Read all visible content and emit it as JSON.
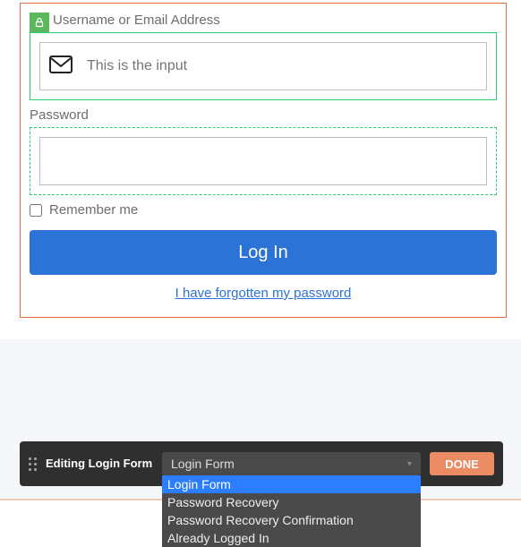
{
  "form": {
    "username_label": "Username or Email Address",
    "username_placeholder": "This is the input",
    "password_label": "Password",
    "remember_label": "Remember me",
    "login_button": "Log In",
    "forgot_link": "I have forgotten my password"
  },
  "editor": {
    "title": "Editing Login Form",
    "selected": "Login Form",
    "done": "DONE",
    "options": [
      "Login Form",
      "Password Recovery",
      "Password Recovery Confirmation",
      "Already Logged In"
    ]
  }
}
